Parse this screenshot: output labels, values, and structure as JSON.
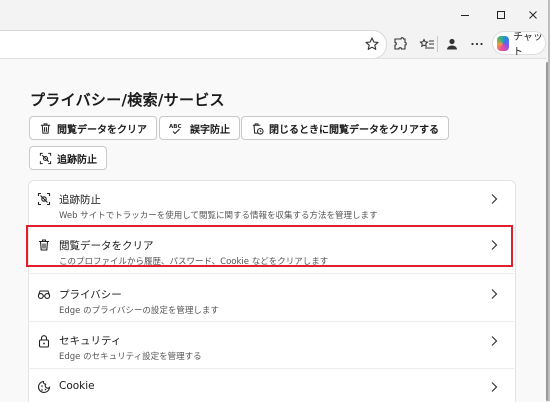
{
  "window": {
    "minimize_glyph": "—",
    "maximize_glyph": "☐",
    "close_glyph": "✕"
  },
  "toolbar": {
    "chat_label": "チャット"
  },
  "page": {
    "heading": "プライバシー/検索/サービス"
  },
  "quick_actions": [
    {
      "label": "閲覧データをクリア",
      "icon": "trash-icon"
    },
    {
      "label": "誤字防止",
      "icon": "spellcheck-icon"
    },
    {
      "label": "閉じるときに閲覧データをクリアする",
      "icon": "clear-on-close-icon"
    },
    {
      "label": "追跡防止",
      "icon": "tracking-prevention-icon"
    }
  ],
  "settings_list": [
    {
      "title": "追跡防止",
      "description": "Web サイトでトラッカーを使用して閲覧に関する情報を収集する方法を管理します",
      "icon": "tracking-prevention-icon"
    },
    {
      "title": "閲覧データをクリア",
      "description": "このプロファイルから履歴、パスワード、Cookie などをクリアします",
      "icon": "trash-icon"
    },
    {
      "title": "プライバシー",
      "description": "Edge のプライバシーの設定を管理します",
      "icon": "glasses-icon"
    },
    {
      "title": "セキュリティ",
      "description": "Edge のセキュリティ設定を管理する",
      "icon": "lock-icon"
    },
    {
      "title": "Cookie",
      "description": "",
      "icon": "cookie-icon"
    }
  ],
  "colors": {
    "highlight": "#e0202a",
    "background": "#f9f9f9",
    "card": "#ffffff"
  }
}
